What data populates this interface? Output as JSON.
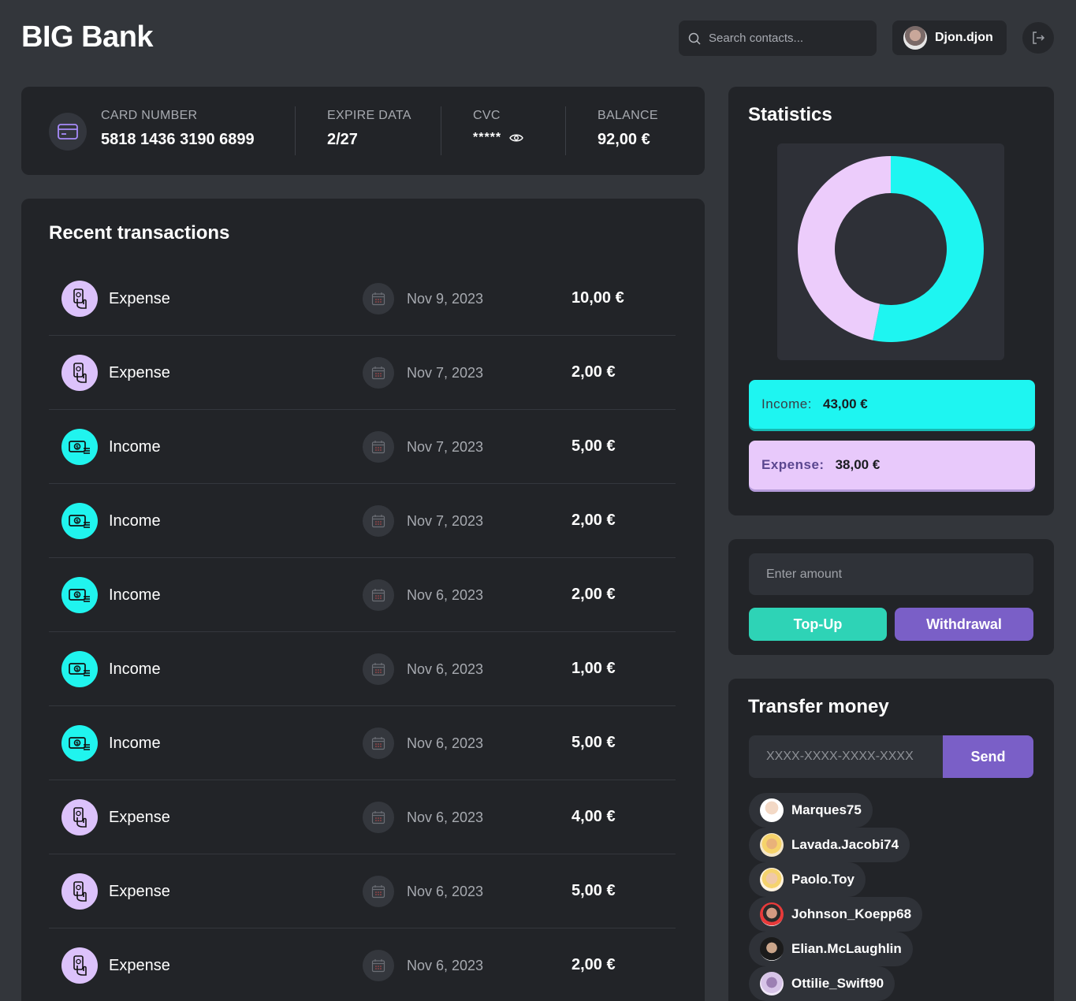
{
  "app": {
    "title": "BIG Bank"
  },
  "header": {
    "search_placeholder": "Search contacts...",
    "user_name": "Djon.djon"
  },
  "card": {
    "number_label": "CARD NUMBER",
    "number": "5818 1436 3190 6899",
    "expire_label": "EXPIRE DATA",
    "expire": "2/27",
    "cvc_label": "CVC",
    "cvc": "*****",
    "balance_label": "BALANCE",
    "balance": "92,00 €"
  },
  "transactions": {
    "title": "Recent transactions",
    "rows": [
      {
        "type": "Expense",
        "date": "Nov 9, 2023",
        "amount": "10,00 €"
      },
      {
        "type": "Expense",
        "date": "Nov 7, 2023",
        "amount": "2,00 €"
      },
      {
        "type": "Income",
        "date": "Nov 7, 2023",
        "amount": "5,00 €"
      },
      {
        "type": "Income",
        "date": "Nov 7, 2023",
        "amount": "2,00 €"
      },
      {
        "type": "Income",
        "date": "Nov 6, 2023",
        "amount": "2,00 €"
      },
      {
        "type": "Income",
        "date": "Nov 6, 2023",
        "amount": "1,00 €"
      },
      {
        "type": "Income",
        "date": "Nov 6, 2023",
        "amount": "5,00 €"
      },
      {
        "type": "Expense",
        "date": "Nov 6, 2023",
        "amount": "4,00 €"
      },
      {
        "type": "Expense",
        "date": "Nov 6, 2023",
        "amount": "5,00 €"
      },
      {
        "type": "Expense",
        "date": "Nov 6, 2023",
        "amount": "2,00 €"
      }
    ]
  },
  "statistics": {
    "title": "Statistics",
    "income_label": "Income:",
    "income_value": "43,00 €",
    "expense_label": "Expense:",
    "expense_value": "38,00 €"
  },
  "chart_data": {
    "type": "pie",
    "categories": [
      "Income",
      "Expense"
    ],
    "values": [
      43,
      38
    ],
    "colors": [
      "#1ef5f1",
      "#ecccfb"
    ]
  },
  "topup": {
    "amount_placeholder": "Enter amount",
    "topup_label": "Top-Up",
    "withdraw_label": "Withdrawal"
  },
  "transfer": {
    "title": "Transfer money",
    "card_placeholder": "XXXX-XXXX-XXXX-XXXX",
    "send_label": "Send",
    "contacts": [
      {
        "name": "Marques75"
      },
      {
        "name": "Lavada.Jacobi74"
      },
      {
        "name": "Paolo.Toy"
      },
      {
        "name": "Johnson_Koepp68"
      },
      {
        "name": "Elian.McLaughlin"
      },
      {
        "name": "Ottilie_Swift90"
      }
    ]
  },
  "colors": {
    "income_accent": "#1ef5f1",
    "expense_accent": "#dcc2fb",
    "topup_button": "#2ed3b6",
    "purple_button": "#7a5fc7"
  }
}
